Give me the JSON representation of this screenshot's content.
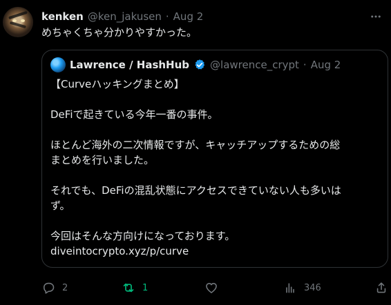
{
  "tweet": {
    "author_name": "kenken",
    "handle": "@ken_jakusen",
    "dot": "·",
    "date": "Aug 2",
    "text": "めちゃくちゃ分かりやすかった。"
  },
  "quoted": {
    "author_name": "Lawrence / HashHub",
    "handle": "@lawrence_crypt",
    "dot": "·",
    "date": "Aug 2",
    "paragraphs": [
      "【Curveハッキングまとめ】",
      "DeFiで起きている今年一番の事件。",
      "ほとんど海外の二次情報ですが、キャッチアップするための総\nまとめを行いました。",
      "それでも、DeFiの混乱状態にアクセスできていない人も多いは\nず。",
      "今回はそんな方向けになっております。"
    ],
    "link": "diveintocrypto.xyz/p/curve"
  },
  "actions": {
    "reply_count": "2",
    "retweet_count": "1",
    "views_count": "346"
  },
  "colors": {
    "background": "#000000",
    "text": "#e7e9ea",
    "muted": "#71767b",
    "retweet_active": "#00ba7c",
    "verified": "#1d9bf0",
    "border": "#2f3336"
  },
  "icons": {
    "more": "more-horizontal-icon",
    "verified": "verified-badge-icon",
    "reply": "reply-icon",
    "retweet": "retweet-icon",
    "like": "heart-icon",
    "views": "views-icon",
    "share": "share-icon"
  }
}
